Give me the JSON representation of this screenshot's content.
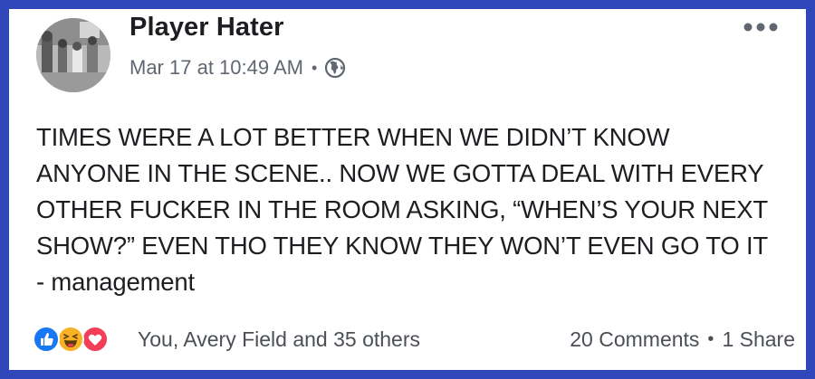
{
  "post": {
    "author": "Player Hater",
    "timestamp": "Mar 17 at 10:49 AM",
    "dot": "•",
    "privacy_icon": "globe-icon",
    "menu_icon": "more-options-icon",
    "body_lines": [
      "TIMES WERE A LOT BETTER WHEN WE DIDN’T KNOW",
      "ANYONE IN THE SCENE.. NOW WE GOTTA DEAL WITH EVERY",
      "OTHER FUCKER IN THE ROOM ASKING, “WHEN’S YOUR NEXT",
      "SHOW?” EVEN THO THEY KNOW THEY WON’T EVEN GO TO IT",
      "- management"
    ]
  },
  "footer": {
    "reaction_icons": [
      "like-icon",
      "haha-icon",
      "love-icon"
    ],
    "reactors": "You, Avery Field and 35 others",
    "comments": "20 Comments",
    "dot": "•",
    "shares": "1 Share"
  },
  "colors": {
    "border": "#2f47b8",
    "like": "#1877f2",
    "haha": "#f7b125",
    "love": "#f33e58",
    "text": "#1c1e21",
    "muted": "#606770"
  }
}
